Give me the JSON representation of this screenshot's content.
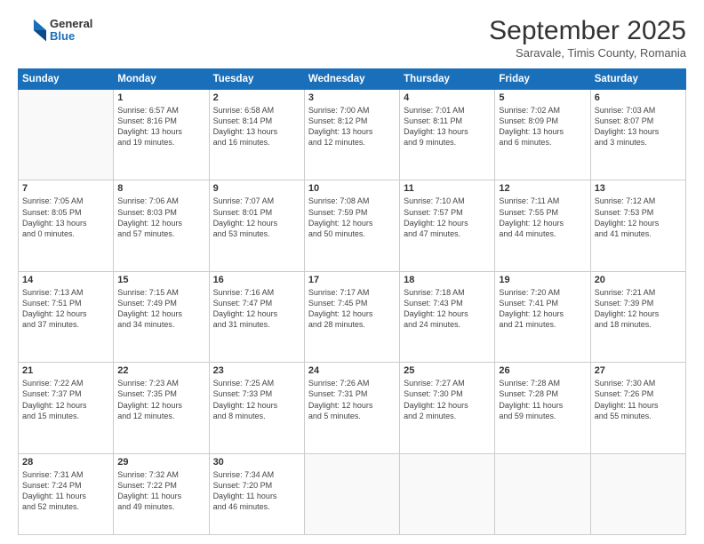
{
  "logo": {
    "general": "General",
    "blue": "Blue"
  },
  "header": {
    "month": "September 2025",
    "location": "Saravale, Timis County, Romania"
  },
  "weekdays": [
    "Sunday",
    "Monday",
    "Tuesday",
    "Wednesday",
    "Thursday",
    "Friday",
    "Saturday"
  ],
  "weeks": [
    [
      {
        "day": "",
        "content": ""
      },
      {
        "day": "1",
        "content": "Sunrise: 6:57 AM\nSunset: 8:16 PM\nDaylight: 13 hours\nand 19 minutes."
      },
      {
        "day": "2",
        "content": "Sunrise: 6:58 AM\nSunset: 8:14 PM\nDaylight: 13 hours\nand 16 minutes."
      },
      {
        "day": "3",
        "content": "Sunrise: 7:00 AM\nSunset: 8:12 PM\nDaylight: 13 hours\nand 12 minutes."
      },
      {
        "day": "4",
        "content": "Sunrise: 7:01 AM\nSunset: 8:11 PM\nDaylight: 13 hours\nand 9 minutes."
      },
      {
        "day": "5",
        "content": "Sunrise: 7:02 AM\nSunset: 8:09 PM\nDaylight: 13 hours\nand 6 minutes."
      },
      {
        "day": "6",
        "content": "Sunrise: 7:03 AM\nSunset: 8:07 PM\nDaylight: 13 hours\nand 3 minutes."
      }
    ],
    [
      {
        "day": "7",
        "content": "Sunrise: 7:05 AM\nSunset: 8:05 PM\nDaylight: 13 hours\nand 0 minutes."
      },
      {
        "day": "8",
        "content": "Sunrise: 7:06 AM\nSunset: 8:03 PM\nDaylight: 12 hours\nand 57 minutes."
      },
      {
        "day": "9",
        "content": "Sunrise: 7:07 AM\nSunset: 8:01 PM\nDaylight: 12 hours\nand 53 minutes."
      },
      {
        "day": "10",
        "content": "Sunrise: 7:08 AM\nSunset: 7:59 PM\nDaylight: 12 hours\nand 50 minutes."
      },
      {
        "day": "11",
        "content": "Sunrise: 7:10 AM\nSunset: 7:57 PM\nDaylight: 12 hours\nand 47 minutes."
      },
      {
        "day": "12",
        "content": "Sunrise: 7:11 AM\nSunset: 7:55 PM\nDaylight: 12 hours\nand 44 minutes."
      },
      {
        "day": "13",
        "content": "Sunrise: 7:12 AM\nSunset: 7:53 PM\nDaylight: 12 hours\nand 41 minutes."
      }
    ],
    [
      {
        "day": "14",
        "content": "Sunrise: 7:13 AM\nSunset: 7:51 PM\nDaylight: 12 hours\nand 37 minutes."
      },
      {
        "day": "15",
        "content": "Sunrise: 7:15 AM\nSunset: 7:49 PM\nDaylight: 12 hours\nand 34 minutes."
      },
      {
        "day": "16",
        "content": "Sunrise: 7:16 AM\nSunset: 7:47 PM\nDaylight: 12 hours\nand 31 minutes."
      },
      {
        "day": "17",
        "content": "Sunrise: 7:17 AM\nSunset: 7:45 PM\nDaylight: 12 hours\nand 28 minutes."
      },
      {
        "day": "18",
        "content": "Sunrise: 7:18 AM\nSunset: 7:43 PM\nDaylight: 12 hours\nand 24 minutes."
      },
      {
        "day": "19",
        "content": "Sunrise: 7:20 AM\nSunset: 7:41 PM\nDaylight: 12 hours\nand 21 minutes."
      },
      {
        "day": "20",
        "content": "Sunrise: 7:21 AM\nSunset: 7:39 PM\nDaylight: 12 hours\nand 18 minutes."
      }
    ],
    [
      {
        "day": "21",
        "content": "Sunrise: 7:22 AM\nSunset: 7:37 PM\nDaylight: 12 hours\nand 15 minutes."
      },
      {
        "day": "22",
        "content": "Sunrise: 7:23 AM\nSunset: 7:35 PM\nDaylight: 12 hours\nand 12 minutes."
      },
      {
        "day": "23",
        "content": "Sunrise: 7:25 AM\nSunset: 7:33 PM\nDaylight: 12 hours\nand 8 minutes."
      },
      {
        "day": "24",
        "content": "Sunrise: 7:26 AM\nSunset: 7:31 PM\nDaylight: 12 hours\nand 5 minutes."
      },
      {
        "day": "25",
        "content": "Sunrise: 7:27 AM\nSunset: 7:30 PM\nDaylight: 12 hours\nand 2 minutes."
      },
      {
        "day": "26",
        "content": "Sunrise: 7:28 AM\nSunset: 7:28 PM\nDaylight: 11 hours\nand 59 minutes."
      },
      {
        "day": "27",
        "content": "Sunrise: 7:30 AM\nSunset: 7:26 PM\nDaylight: 11 hours\nand 55 minutes."
      }
    ],
    [
      {
        "day": "28",
        "content": "Sunrise: 7:31 AM\nSunset: 7:24 PM\nDaylight: 11 hours\nand 52 minutes."
      },
      {
        "day": "29",
        "content": "Sunrise: 7:32 AM\nSunset: 7:22 PM\nDaylight: 11 hours\nand 49 minutes."
      },
      {
        "day": "30",
        "content": "Sunrise: 7:34 AM\nSunset: 7:20 PM\nDaylight: 11 hours\nand 46 minutes."
      },
      {
        "day": "",
        "content": ""
      },
      {
        "day": "",
        "content": ""
      },
      {
        "day": "",
        "content": ""
      },
      {
        "day": "",
        "content": ""
      }
    ]
  ]
}
